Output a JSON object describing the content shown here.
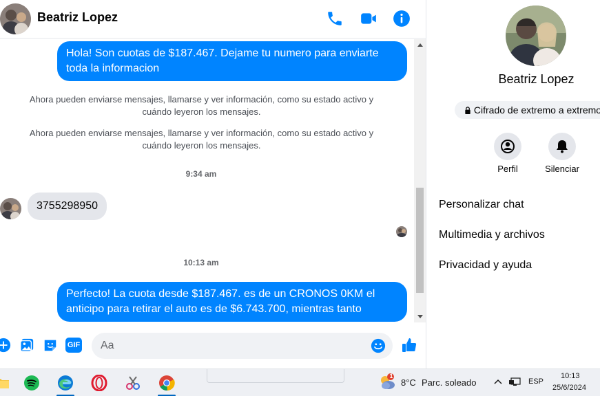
{
  "header": {
    "contact_name": "Beatriz Lopez",
    "phone_icon": "phone-icon",
    "video_icon": "video-camera-icon",
    "info_icon": "info-icon"
  },
  "messages": {
    "outgoing_1": "Hola! Son cuotas de $187.467. Dejame tu numero para enviarte toda la informacion",
    "system_1": "Ahora pueden enviarse mensajes, llamarse y ver información, como su estado activo y cuándo leyeron los mensajes.",
    "system_2": "Ahora pueden enviarse mensajes, llamarse y ver información, como su estado activo y cuándo leyeron los mensajes.",
    "time_1": "9:34 am",
    "incoming_1": "3755298950",
    "time_2": "10:13 am",
    "outgoing_2": "Perfecto! La cuota desde $187.467. es de un CRONOS 0KM el anticipo para retirar el auto es de $6.743.700, mientras tanto"
  },
  "composer": {
    "placeholder": "Aa",
    "icons": [
      "plus-icon",
      "image-icon",
      "sticker-icon",
      "gif-icon",
      "emoji-icon",
      "thumbs-up-icon"
    ],
    "gif_label": "GIF"
  },
  "info_panel": {
    "name": "Beatriz Lopez",
    "encryption": "Cifrado de extremo a extremo",
    "profile_label": "Perfil",
    "mute_label": "Silenciar",
    "menu": [
      "Personalizar chat",
      "Multimedia y archivos",
      "Privacidad y ayuda"
    ]
  },
  "taskbar": {
    "weather_temp": "8°C",
    "weather_desc": "Parc. soleado",
    "weather_badge": "1",
    "language": "ESP",
    "time": "10:13",
    "date": "25/6/2024",
    "apps": [
      "file-explorer-icon",
      "spotify-icon",
      "edge-icon",
      "opera-icon",
      "snipping-tool-icon",
      "chrome-icon"
    ]
  },
  "colors": {
    "accent": "#0084ff",
    "incoming_bubble": "#e4e6eb",
    "taskbar": "#eef0f4"
  }
}
